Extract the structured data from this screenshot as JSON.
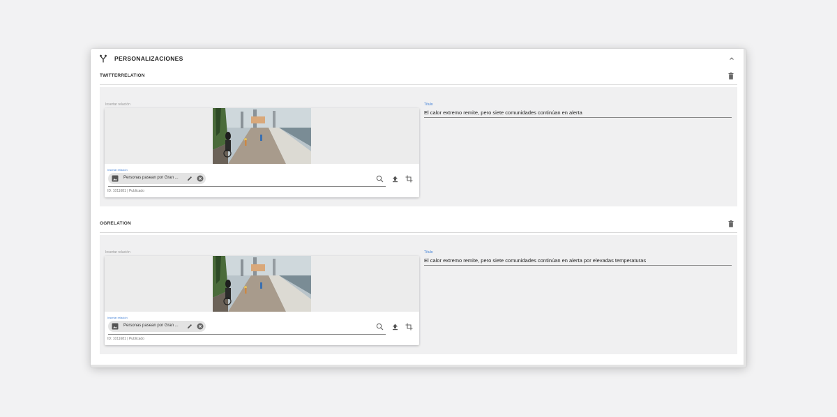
{
  "panel": {
    "title": "PERSONALIZACIONES"
  },
  "sections": [
    {
      "title": "TWITTERRELATION",
      "insert_label": "Insertar relación",
      "inner_label": "Insertar relación",
      "chip_text": "Personas pasean por Gran ...",
      "meta": "ID: 1011681 | Publicado",
      "titulo_label": "Título",
      "titulo_value": "El calor extremo remite, pero siete comunidades continúan en alerta"
    },
    {
      "title": "OGRELATION",
      "insert_label": "Insertar relación",
      "inner_label": "Insertar relación",
      "chip_text": "Personas pasean por Gran ...",
      "meta": "ID: 1011681 | Publicado",
      "titulo_label": "Título",
      "titulo_value": "El calor extremo remite, pero siete comunidades continúan en alerta por elevadas temperaturas"
    }
  ],
  "icons": {
    "panel": "fork-icon",
    "collapse": "chevron-up-icon",
    "delete": "trash-icon",
    "chip_image": "image-icon",
    "chip_edit": "pencil-icon",
    "chip_remove": "close-circle-icon",
    "search": "search-icon",
    "upload": "upload-icon",
    "crop": "crop-icon"
  },
  "colors": {
    "accent": "#3f7fd6",
    "background": "#f2f2f3",
    "section_background": "#f0f0f1"
  }
}
